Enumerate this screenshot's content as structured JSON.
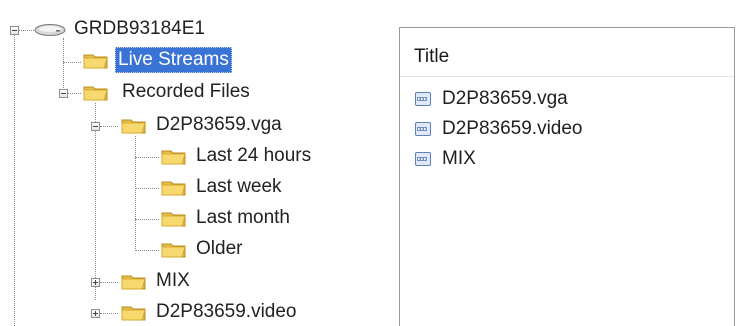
{
  "tree": {
    "root": {
      "label": "GRDB93184E1",
      "icon": "drive-icon"
    },
    "items": [
      {
        "label": "Live Streams",
        "icon": "folder-icon",
        "selected": true
      },
      {
        "label": "Recorded Files",
        "icon": "folder-icon"
      },
      {
        "label": "D2P83659.vga",
        "icon": "folder-icon"
      },
      {
        "label": "Last 24 hours",
        "icon": "folder-icon"
      },
      {
        "label": "Last week",
        "icon": "folder-icon"
      },
      {
        "label": "Last month",
        "icon": "folder-icon"
      },
      {
        "label": "Older",
        "icon": "folder-icon"
      },
      {
        "label": "MIX",
        "icon": "folder-icon"
      },
      {
        "label": "D2P83659.video",
        "icon": "folder-icon"
      }
    ]
  },
  "list": {
    "header": "Title",
    "items": [
      {
        "label": "D2P83659.vga",
        "icon": "video-file-icon"
      },
      {
        "label": "D2P83659.video",
        "icon": "video-file-icon"
      },
      {
        "label": "MIX",
        "icon": "video-file-icon"
      }
    ]
  },
  "colors": {
    "selection": "#3a73d6",
    "folder": "#f4d36a",
    "folder_dark": "#d5ac2d",
    "line": "#8a8a8a"
  }
}
